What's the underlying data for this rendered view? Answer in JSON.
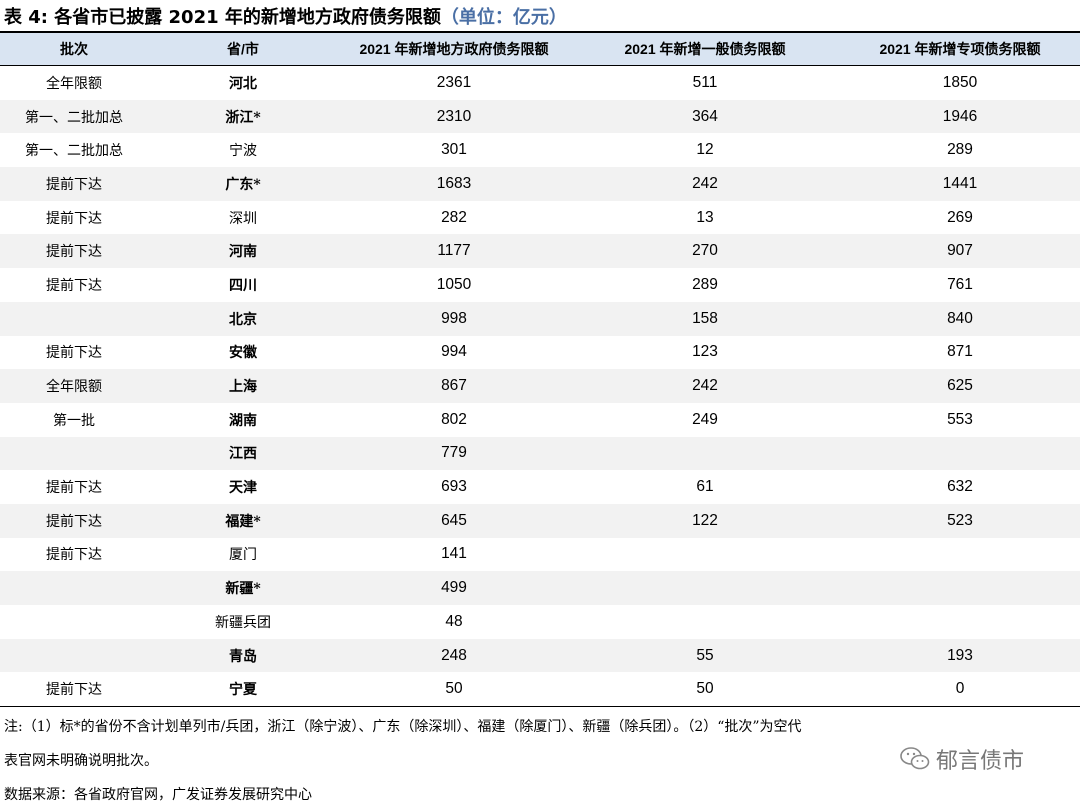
{
  "title": {
    "main": "表 4:  各省市已披露 2021 年的新增地方政府债务限额",
    "unit": "（单位：亿元）"
  },
  "table": {
    "headers": [
      "批次",
      "省/市",
      "2021 年新增地方政府债务限额",
      "2021 年新增一般债务限额",
      "2021 年新增专项债务限额"
    ],
    "rows": [
      {
        "batch": "全年限额",
        "province": "河北",
        "total": "2361",
        "general": "511",
        "special": "1850"
      },
      {
        "batch": "第一、二批加总",
        "province": "浙江*",
        "total": "2310",
        "general": "364",
        "special": "1946"
      },
      {
        "batch": "第一、二批加总",
        "province": "宁波",
        "total": "301",
        "general": "12",
        "special": "289"
      },
      {
        "batch": "提前下达",
        "province": "广东*",
        "total": "1683",
        "general": "242",
        "special": "1441"
      },
      {
        "batch": "提前下达",
        "province": "深圳",
        "total": "282",
        "general": "13",
        "special": "269"
      },
      {
        "batch": "提前下达",
        "province": "河南",
        "total": "1177",
        "general": "270",
        "special": "907"
      },
      {
        "batch": "提前下达",
        "province": "四川",
        "total": "1050",
        "general": "289",
        "special": "761"
      },
      {
        "batch": "",
        "province": "北京",
        "total": "998",
        "general": "158",
        "special": "840"
      },
      {
        "batch": "提前下达",
        "province": "安徽",
        "total": "994",
        "general": "123",
        "special": "871"
      },
      {
        "batch": "全年限额",
        "province": "上海",
        "total": "867",
        "general": "242",
        "special": "625"
      },
      {
        "batch": "第一批",
        "province": "湖南",
        "total": "802",
        "general": "249",
        "special": "553"
      },
      {
        "batch": "",
        "province": "江西",
        "total": "779",
        "general": "",
        "special": ""
      },
      {
        "batch": "提前下达",
        "province": "天津",
        "total": "693",
        "general": "61",
        "special": "632"
      },
      {
        "batch": "提前下达",
        "province": "福建*",
        "total": "645",
        "general": "122",
        "special": "523"
      },
      {
        "batch": "提前下达",
        "province": "厦门",
        "total": "141",
        "general": "",
        "special": ""
      },
      {
        "batch": "",
        "province": "新疆*",
        "total": "499",
        "general": "",
        "special": ""
      },
      {
        "batch": "",
        "province": "新疆兵团",
        "total": "48",
        "general": "",
        "special": ""
      },
      {
        "batch": "",
        "province": "青岛",
        "total": "248",
        "general": "55",
        "special": "193"
      },
      {
        "batch": "提前下达",
        "province": "宁夏",
        "total": "50",
        "general": "50",
        "special": "0"
      }
    ]
  },
  "notes": {
    "line1": "注:（1）标*的省份不含计划单列市/兵团，浙江（除宁波）、广东（除深圳）、福建（除厦门）、新疆（除兵团）。（2）“批次”为空代",
    "line2": "表官网未明确说明批次。",
    "source": "数据来源：各省政府官网，广发证券发展研究中心"
  },
  "watermark": {
    "text": "郁言债市",
    "icon": "wechat-icon"
  }
}
